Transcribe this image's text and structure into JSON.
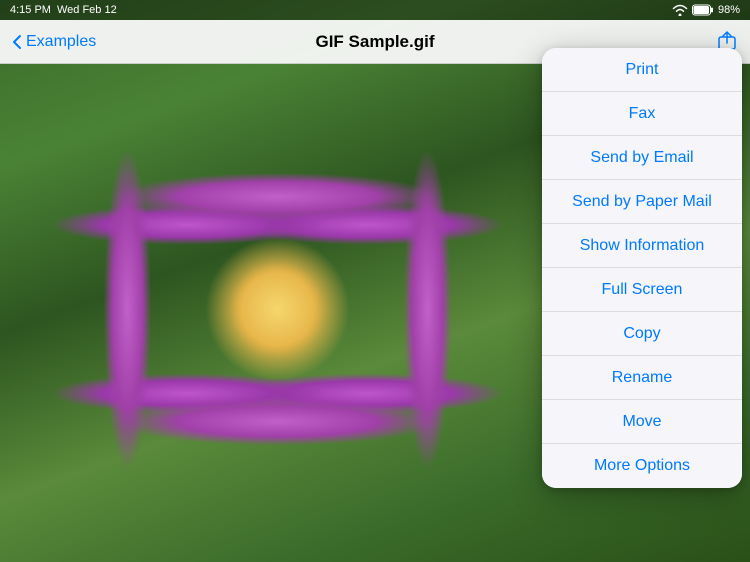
{
  "status_bar": {
    "time": "4:15 PM",
    "day_date": "Wed Feb 12",
    "wifi_icon": "wifi",
    "battery": "98%",
    "battery_label": "98%"
  },
  "nav_bar": {
    "back_label": "Examples",
    "title": "GIF Sample.gif",
    "action_icon": "share"
  },
  "menu": {
    "items": [
      {
        "id": "print",
        "label": "Print"
      },
      {
        "id": "fax",
        "label": "Fax"
      },
      {
        "id": "send-email",
        "label": "Send by Email"
      },
      {
        "id": "send-paper-mail",
        "label": "Send by Paper Mail"
      },
      {
        "id": "show-info",
        "label": "Show Information"
      },
      {
        "id": "full-screen",
        "label": "Full Screen"
      },
      {
        "id": "copy",
        "label": "Copy"
      },
      {
        "id": "rename",
        "label": "Rename"
      },
      {
        "id": "move",
        "label": "Move"
      },
      {
        "id": "more-options",
        "label": "More Options"
      }
    ]
  }
}
